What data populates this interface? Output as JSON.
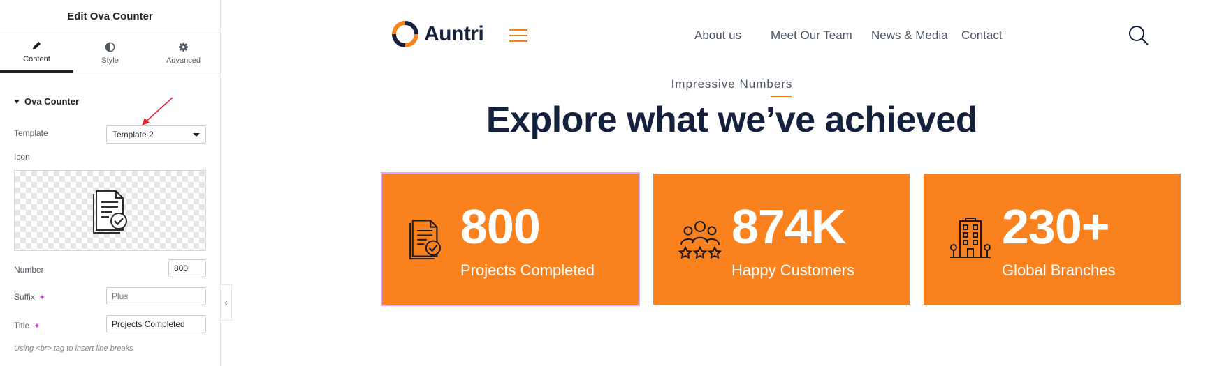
{
  "panel": {
    "title": "Edit Ova Counter",
    "tabs": [
      {
        "label": "Content",
        "icon": "pencil-icon",
        "active": true
      },
      {
        "label": "Style",
        "icon": "contrast-icon",
        "active": false
      },
      {
        "label": "Advanced",
        "icon": "gear-icon",
        "active": false
      }
    ],
    "section": "Ova Counter",
    "template_label": "Template",
    "template_value": "Template 2",
    "icon_label": "Icon",
    "number_label": "Number",
    "number_value": "800",
    "suffix_label": "Suffix",
    "suffix_placeholder": "Plus",
    "title_label": "Title",
    "title_value": "Projects Completed",
    "hint": "Using <br> tag to insert line breaks",
    "collapse_glyph": "‹"
  },
  "site": {
    "logo": "Auntri",
    "nav": [
      "About us",
      "Meet Our Team",
      "News & Media",
      "Contact"
    ],
    "kicker": "Impressive Numbers",
    "headline": "Explore what we’ve achieved",
    "accent": "#fa821e",
    "counters": [
      {
        "number": "800",
        "title": "Projects Completed",
        "icon": "document-check-icon"
      },
      {
        "number": "874K",
        "title": "Happy Customers",
        "icon": "customers-stars-icon"
      },
      {
        "number": "230+",
        "title": "Global Branches",
        "icon": "building-icon"
      }
    ]
  }
}
